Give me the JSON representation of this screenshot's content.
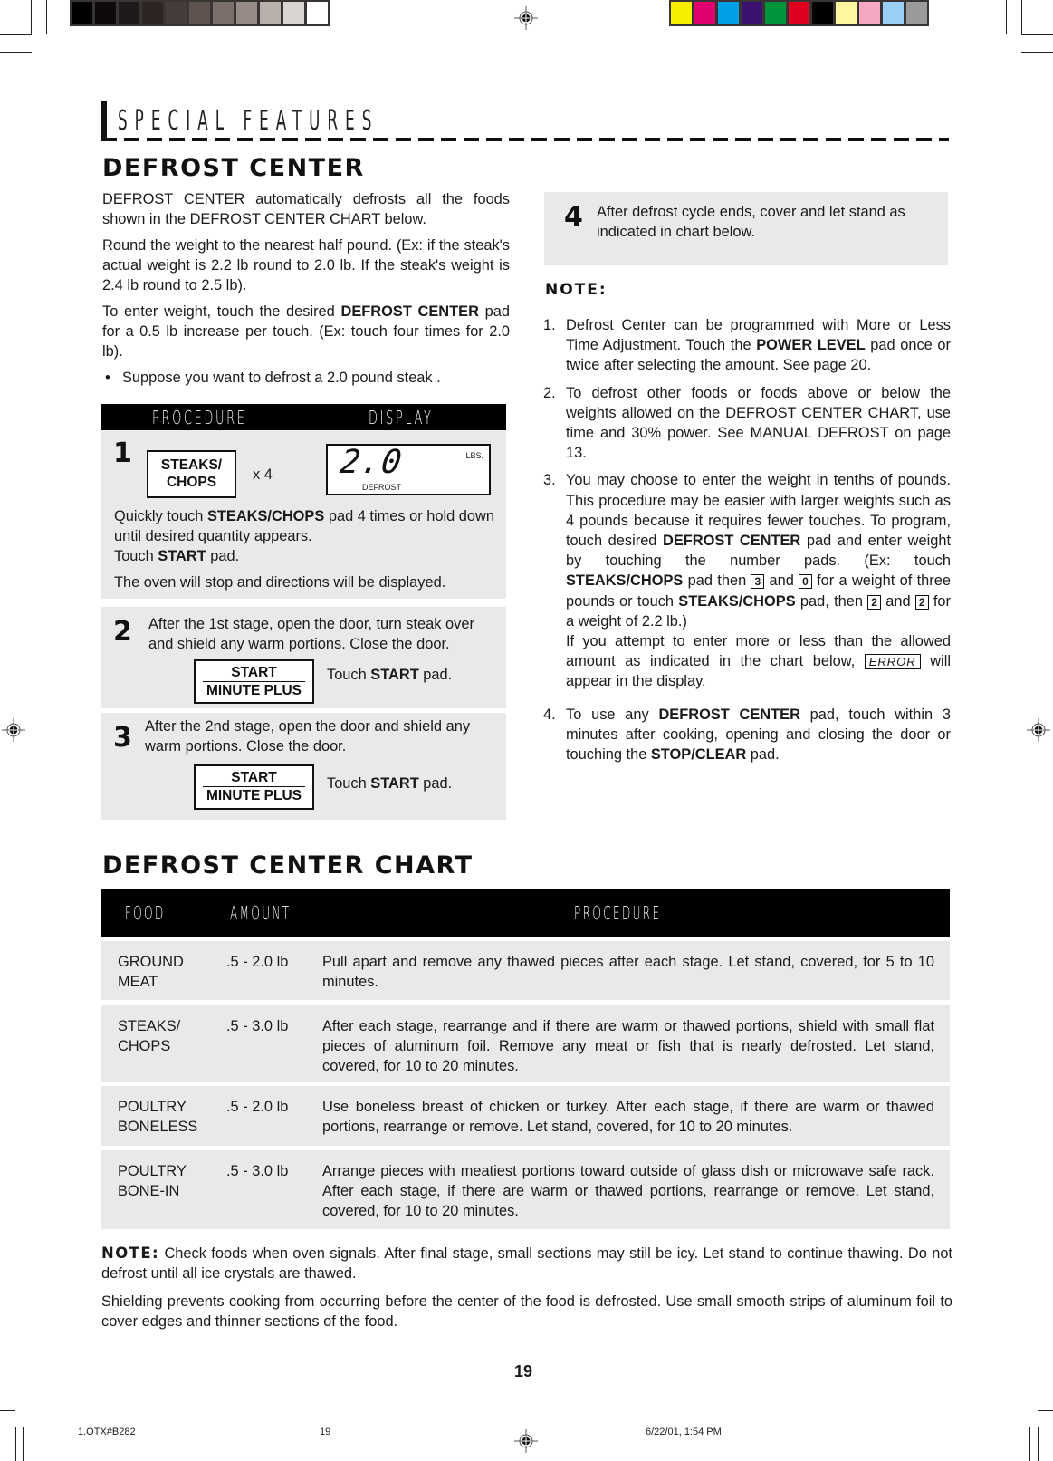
{
  "header": {
    "section_label": "SPECIAL FEATURES",
    "title": "DEFROST CENTER"
  },
  "intro": {
    "p1": "DEFROST CENTER automatically defrosts all the foods shown in the DEFROST CENTER CHART below.",
    "p2": "Round the weight to the nearest half pound. (Ex: if the steak's actual weight is 2.2 lb round to 2.0 lb. If the steak's weight is 2.4 lb round to 2.5 lb).",
    "p3_pre": "To enter weight, touch the desired ",
    "p3_bold": "DEFROST CENTER",
    "p3_post": " pad for a 0.5 lb increase per touch. (Ex: touch four times for 2.0 lb).",
    "bullet": "Suppose you want to defrost a 2.0 pound steak ."
  },
  "procedure": {
    "col_procedure": "PROCEDURE",
    "col_display": "DISPLAY",
    "steps": [
      {
        "num": "1",
        "pad_line1": "STEAKS/",
        "pad_line2": "CHOPS",
        "times": "x 4",
        "display_value": "2.0",
        "display_unit": "LBS.",
        "display_mode": "DEFROST",
        "text_a_pre": "Quickly touch ",
        "text_a_bold": "STEAKS/CHOPS",
        "text_a_post": " pad 4 times or hold down until desired quantity appears.",
        "text_b_pre": "Touch ",
        "text_b_bold": "START",
        "text_b_post": " pad.",
        "text_c": "The oven will stop and directions will be displayed."
      },
      {
        "num": "2",
        "text": "After the 1st stage, open the door, turn steak over and shield any warm portions. Close the door.",
        "pad_top": "START",
        "pad_bottom": "MINUTE PLUS",
        "touch_pre": "Touch ",
        "touch_bold": "START",
        "touch_post": " pad."
      },
      {
        "num": "3",
        "text": "After the 2nd stage, open the door and shield any warm portions. Close the door.",
        "pad_top": "START",
        "pad_bottom": "MINUTE PLUS",
        "touch_pre": "Touch ",
        "touch_bold": "START",
        "touch_post": " pad."
      },
      {
        "num": "4",
        "text": "After defrost cycle ends, cover and let stand as indicated in chart below."
      }
    ]
  },
  "notes": {
    "title": "NOTE:",
    "items": [
      {
        "n": "1.",
        "pre": "Defrost Center can be programmed with More or Less Time Adjustment. Touch the ",
        "bold": "POWER LEVEL",
        "post": " pad once or twice after selecting the amount. See page 20."
      },
      {
        "n": "2.",
        "text": "To defrost other foods or foods above or below the weights allowed on the DEFROST CENTER CHART, use time and 30% power. See MANUAL DEFROST on page 13."
      },
      {
        "n": "3.",
        "a": "You may choose to enter the weight in tenths of pounds. This procedure may be easier with larger weights such as 4 pounds because it requires fewer touches. To program, touch desired ",
        "b": "DEFROST CENTER",
        "c": " pad and enter weight by touching the number pads. (Ex: touch ",
        "d": "STEAKS/CHOPS",
        "e": " pad then ",
        "k1": "3",
        "f": " and ",
        "k2": "0",
        "g": " for a weight of three pounds or touch ",
        "h": "STEAKS/CHOPS",
        "i": " pad, then ",
        "k3": "2",
        "j": " and ",
        "k4": "2",
        "k": " for a weight of 2.2 lb.)",
        "l": "If you attempt to enter more or less than the allowed amount as indicated in the chart below, ",
        "err": "ERROR",
        "m": " will appear in the display."
      },
      {
        "n": "4.",
        "a": "To use any ",
        "b": "DEFROST CENTER",
        "c": " pad, touch within 3 minutes after cooking, opening and closing the door or touching the ",
        "d": "STOP/CLEAR",
        "e": " pad."
      }
    ]
  },
  "chart": {
    "title": "DEFROST CENTER CHART",
    "headers": [
      "FOOD",
      "AMOUNT",
      "PROCEDURE"
    ],
    "rows": [
      {
        "food": "GROUND MEAT",
        "amount": ".5 - 2.0 lb",
        "procedure": "Pull apart and remove any thawed pieces after each stage. Let stand, covered, for 5 to 10 minutes."
      },
      {
        "food": "STEAKS/ CHOPS",
        "amount": ".5 - 3.0 lb",
        "procedure": "After each stage, rearrange and if there are warm or thawed portions, shield with small flat pieces of aluminum foil. Remove any meat or fish that is nearly defrosted. Let stand, covered, for 10 to 20 minutes."
      },
      {
        "food": "POULTRY BONELESS",
        "amount": ".5 - 2.0 lb",
        "procedure": "Use boneless breast of chicken or turkey. After each stage, if there are warm or thawed portions, rearrange or remove. Let stand, covered, for 10 to 20 minutes."
      },
      {
        "food": "POULTRY BONE-IN",
        "amount": ".5 - 3.0 lb",
        "procedure": "Arrange pieces with meatiest portions toward outside of glass dish or microwave safe rack. After each stage, if there are warm or thawed portions, rearrange or remove. Let stand, covered, for 10 to 20 minutes."
      }
    ]
  },
  "footer_notes": {
    "note_label": "NOTE:",
    "note_text": " Check foods when oven signals. After final stage, small sections may still be icy. Let stand to continue thawing. Do not defrost until all ice crystals are thawed.",
    "shielding": "Shielding prevents cooking from occurring before the center of the food is defrosted. Use small smooth strips of aluminum foil to cover edges and thinner sections of the food."
  },
  "page_number": "19",
  "print_slug": {
    "file": "1.OTX#B282",
    "page": "19",
    "timestamp": "6/22/01, 1:54 PM"
  },
  "color_bars": {
    "gray": [
      "#000000",
      "#0f0a0a",
      "#1f1a19",
      "#2e2523",
      "#463d3a",
      "#5f5350",
      "#7b6f6b",
      "#978b87",
      "#b9afab",
      "#dbd5d2",
      "#ffffff"
    ],
    "process": [
      "#f7ee00",
      "#e0006e",
      "#00a0e6",
      "#3b1270",
      "#00953a",
      "#e00022",
      "#000000",
      "#fff6a0",
      "#f5a8c0",
      "#9ad0f5",
      "#9a9a9a"
    ]
  }
}
